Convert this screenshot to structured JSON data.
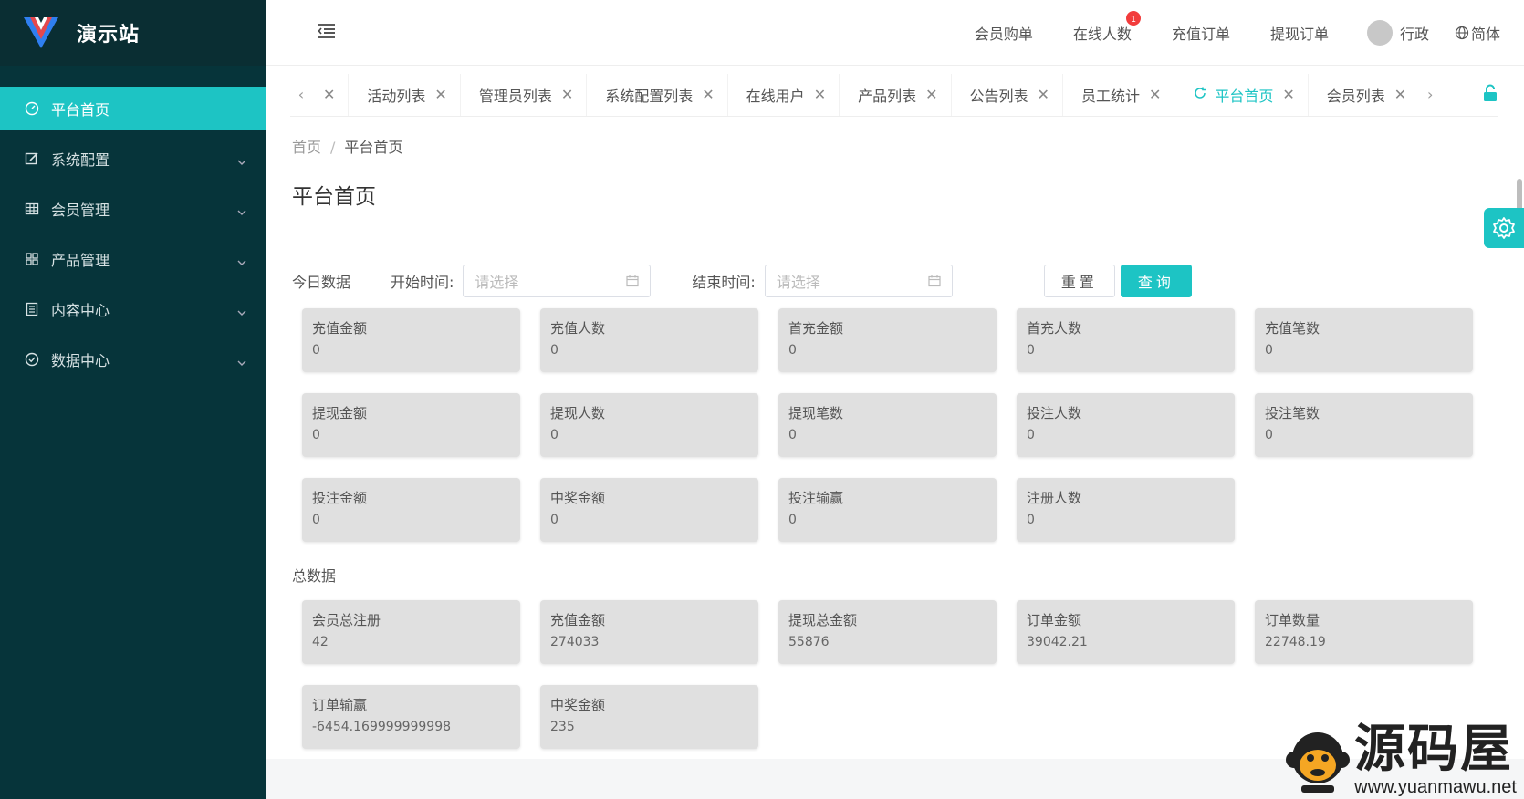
{
  "app": {
    "title": "演示站"
  },
  "sidebar": {
    "items": [
      {
        "label": "平台首页",
        "active": true,
        "icon": "dashboard-icon",
        "has_children": false
      },
      {
        "label": "系统配置",
        "active": false,
        "icon": "edit-icon",
        "has_children": true
      },
      {
        "label": "会员管理",
        "active": false,
        "icon": "table-icon",
        "has_children": true
      },
      {
        "label": "产品管理",
        "active": false,
        "icon": "grid-icon",
        "has_children": true
      },
      {
        "label": "内容中心",
        "active": false,
        "icon": "document-icon",
        "has_children": true
      },
      {
        "label": "数据中心",
        "active": false,
        "icon": "check-circle-icon",
        "has_children": true
      }
    ]
  },
  "header": {
    "links": [
      {
        "label": "会员购单"
      },
      {
        "label": "在线人数",
        "badge": "1"
      },
      {
        "label": "充值订单"
      },
      {
        "label": "提现订单"
      }
    ],
    "user_name": "行政",
    "language": "简体"
  },
  "tabs": [
    {
      "label": "",
      "active": false
    },
    {
      "label": "活动列表",
      "active": false
    },
    {
      "label": "管理员列表",
      "active": false
    },
    {
      "label": "系统配置列表",
      "active": false
    },
    {
      "label": "在线用户",
      "active": false
    },
    {
      "label": "产品列表",
      "active": false
    },
    {
      "label": "公告列表",
      "active": false
    },
    {
      "label": "员工统计",
      "active": false
    },
    {
      "label": "平台首页",
      "active": true
    },
    {
      "label": "会员列表",
      "active": false
    }
  ],
  "breadcrumb": {
    "home": "首页",
    "separator": "/",
    "current": "平台首页"
  },
  "page_title": "平台首页",
  "filter": {
    "today_label": "今日数据",
    "start_label": "开始时间:",
    "start_placeholder": "请选择",
    "end_label": "结束时间:",
    "end_placeholder": "请选择",
    "reset_label": "重置",
    "query_label": "查询"
  },
  "today_stats": [
    {
      "label": "充值金额",
      "value": "0"
    },
    {
      "label": "充值人数",
      "value": "0"
    },
    {
      "label": "首充金额",
      "value": "0"
    },
    {
      "label": "首充人数",
      "value": "0"
    },
    {
      "label": "充值笔数",
      "value": "0"
    },
    {
      "label": "提现金额",
      "value": "0"
    },
    {
      "label": "提现人数",
      "value": "0"
    },
    {
      "label": "提现笔数",
      "value": "0"
    },
    {
      "label": "投注人数",
      "value": "0"
    },
    {
      "label": "投注笔数",
      "value": "0"
    },
    {
      "label": "投注金额",
      "value": "0"
    },
    {
      "label": "中奖金额",
      "value": "0"
    },
    {
      "label": "投注输赢",
      "value": "0"
    },
    {
      "label": "注册人数",
      "value": "0"
    }
  ],
  "total_label": "总数据",
  "total_stats": [
    {
      "label": "会员总注册",
      "value": "42"
    },
    {
      "label": "充值金额",
      "value": "274033"
    },
    {
      "label": "提现总金额",
      "value": "55876"
    },
    {
      "label": "订单金额",
      "value": "39042.21"
    },
    {
      "label": "订单数量",
      "value": "22748.19"
    },
    {
      "label": "订单输赢",
      "value": "-6454.169999999998"
    },
    {
      "label": "中奖金额",
      "value": "235"
    }
  ],
  "watermark": {
    "brand": "源码屋",
    "url": "www.yuanmawu.net"
  },
  "colors": {
    "accent": "#1dc4c4",
    "sidebar_bg": "#06343a",
    "card_bg": "#e0e0e0",
    "badge": "#f23c3c"
  }
}
